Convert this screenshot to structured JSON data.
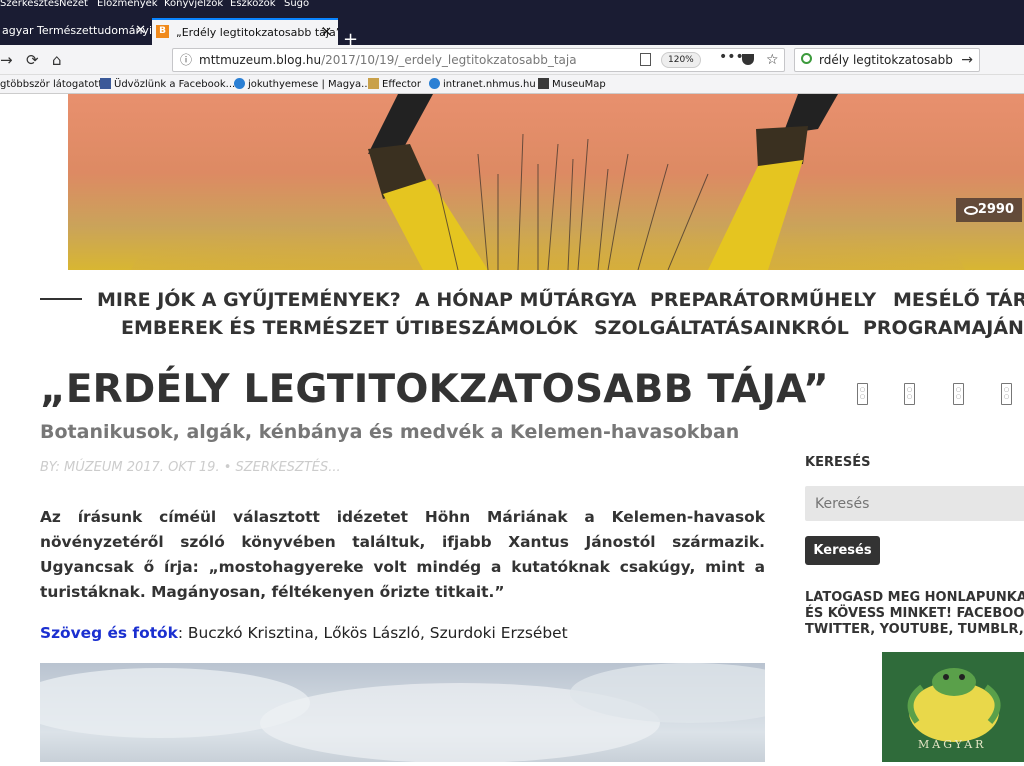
{
  "menu": [
    "Szerkesztés",
    "Nézet",
    "Előzmények",
    "Könyvjelzők",
    "Eszközök",
    "Súgó"
  ],
  "tabs": [
    {
      "label": "agyar Természettudományi M",
      "active": false
    },
    {
      "label": "„Erdély legtitokzatosabb tája” -",
      "active": true,
      "favicon": "B"
    }
  ],
  "address": {
    "host": "mttmuzeum.blog.hu",
    "path": "/2017/10/19/_erdely_legtitokzatosabb_taja",
    "zoom": "120%"
  },
  "search_box": {
    "value": "rdély legtitokzatosabb tája"
  },
  "bookmarks": [
    "gtöbbször látogatott",
    "Üdvözlünk a Facebook...",
    "jokuthyemese | Magya...",
    "Effector",
    "intranet.nhmus.hu",
    "MuseuMap"
  ],
  "hero": {
    "views": "2990"
  },
  "nav": [
    "MIRE JÓK A GYŰJTEMÉNYEK?",
    "A HÓNAP MŰTÁRGYA",
    "PREPARÁTORMŰHELY",
    "MESÉLŐ TÁRG",
    "EMBEREK ÉS TERMÉSZET",
    "ÚTIBESZÁMOLÓK",
    "SZOLGÁLTATÁSAINKRÓL",
    "PROGRAMAJÁNL"
  ],
  "article": {
    "title": "„ERDÉLY LEGTITOKZATOSABB TÁJA”",
    "subtitle": "Botanikusok, algák, kénbánya és medvék a Kelemen-havasokban",
    "byline": "BY: MÚZEUM 2017. OKT 19. • SZERKESZTÉS...",
    "intro": "Az írásunk címéül választott idézetet Höhn Máriának a Kelemen-havasok növényzetéről szóló könyvében találtuk, ifjabb Xantus Jánostól származik. Ugyancsak ő írja: „mostohagyereke volt mindég a kutatóknak csakúgy, mint a turistáknak. Magányosan, féltékenyen őrizte titkait.”",
    "credits_label": "Szöveg és fotók",
    "credits": ": Buczkó Krisztina, Lőkös László, Szurdoki Erzsébet"
  },
  "sidebar": {
    "search_heading": "KERESÉS",
    "search_placeholder": "Keresés",
    "search_button": "Keresés",
    "visit_text": "LÁTOGASD MEG HONLAPUNKA\nÉS KÖVESS MINKET! FACEBOOK\nTWITTER, YOUTUBE, TUMBLR, P",
    "logo_text": "MAGYAR"
  }
}
